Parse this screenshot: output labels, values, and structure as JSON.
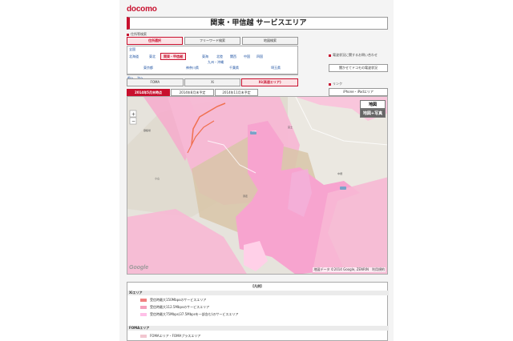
{
  "header": {
    "logo": "docomo",
    "title": "関東・甲信越 サービスエリア"
  },
  "search": {
    "section_label": "住所等検索",
    "tabs": [
      {
        "label": "住所選択",
        "active": true
      },
      {
        "label": "フリーワード検索",
        "active": false
      },
      {
        "label": "地図検索",
        "active": false
      }
    ]
  },
  "regions": {
    "all_label": "全国",
    "items": [
      {
        "label": "北海道",
        "active": false
      },
      {
        "label": "東北",
        "active": false
      },
      {
        "label": "関東・甲信越",
        "active": true
      },
      {
        "label": "東海",
        "active": false
      },
      {
        "label": "北陸",
        "active": false
      },
      {
        "label": "関西",
        "active": false
      },
      {
        "label": "中国",
        "active": false
      },
      {
        "label": "四国",
        "active": false
      }
    ],
    "kyushu": "九州・沖縄",
    "prefectures": [
      "東京都",
      "神奈川県",
      "千葉県",
      "埼玉県"
    ],
    "pager": "前へ　次へ"
  },
  "network_tabs": [
    {
      "label": "FOMA",
      "active": false
    },
    {
      "label": "Xi",
      "active": false
    },
    {
      "label": "Xi(高速エリア)",
      "active": true
    }
  ],
  "date_tabs": [
    {
      "label": "2014年5月末時点",
      "active": true
    },
    {
      "label": "2014年8月末予定",
      "active": false
    },
    {
      "label": "2014年11月末予定",
      "active": false
    }
  ],
  "sidebar": {
    "notice": "電波状況に関するお問い合わせ",
    "notice_button": "聞かせてドコモの電波状況",
    "link_label": "リンク",
    "link_button": "iPhone・iPadエリア"
  },
  "map": {
    "btn_map": "地図",
    "btn_satellite": "地図+写真",
    "copyright": "地図データ ©2014 Google, ZENRIN　利用規約",
    "google": "Google",
    "route_label": "138",
    "labels": [
      "御殿場",
      "小山",
      "須走",
      "中畑",
      "富士"
    ]
  },
  "legend": {
    "title": "【凡例】",
    "xi_header": "Xiエリア",
    "items": [
      {
        "label": "受信時最大150Mbpsのサービスエリア",
        "color": "#f08080"
      },
      {
        "label": "受信時最大112.5Mbpsのサービスエリア",
        "color": "#f5a0bc"
      },
      {
        "label": "受信時最大75Mbps(37.5Mbpsを一部含む)のサービスエリア",
        "color": "#ffc0e8"
      }
    ],
    "foma_header": "FOMAエリア",
    "foma_item": {
      "label": "FOMAエリア・FOMAプラスエリア",
      "color": "#f2c6d0"
    }
  },
  "colors": {
    "brand": "#c8102e",
    "link": "#1a4fa0"
  }
}
